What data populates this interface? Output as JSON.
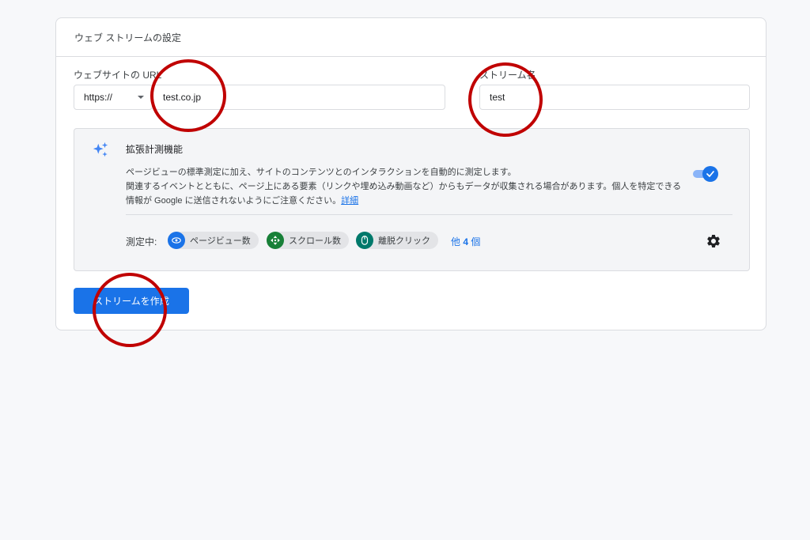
{
  "header": {
    "title": "ウェブ ストリームの設定"
  },
  "url_section": {
    "label": "ウェブサイトの URL",
    "protocol_value": "https://",
    "url_value": "test.co.jp"
  },
  "stream_section": {
    "label": "ストリーム名",
    "value": "test"
  },
  "enhanced_measurement": {
    "title": "拡張計測機能",
    "description_line1": "ページビューの標準測定に加え、サイトのコンテンツとのインタラクションを自動的に測定します。",
    "description_line2": "関連するイベントとともに、ページ上にある要素（リンクや埋め込み動画など）からもデータが収集される場合があります。個人を特定できる",
    "description_line3": "情報が Google に送信されないようにご注意ください。",
    "details_link": "詳細",
    "toggle_on": true,
    "measuring_label": "測定中:",
    "chips": [
      {
        "label": "ページビュー数",
        "icon": "eye-icon",
        "color": "#1a73e8"
      },
      {
        "label": "スクロール数",
        "icon": "scroll-icon",
        "color": "#188038"
      },
      {
        "label": "離脱クリック",
        "icon": "mouse-icon",
        "color": "#00796b"
      }
    ],
    "more_prefix": "他",
    "more_count": "4",
    "more_suffix": "個"
  },
  "create_button": {
    "label": "ストリームを作成"
  },
  "annotation_color": "#c00000"
}
